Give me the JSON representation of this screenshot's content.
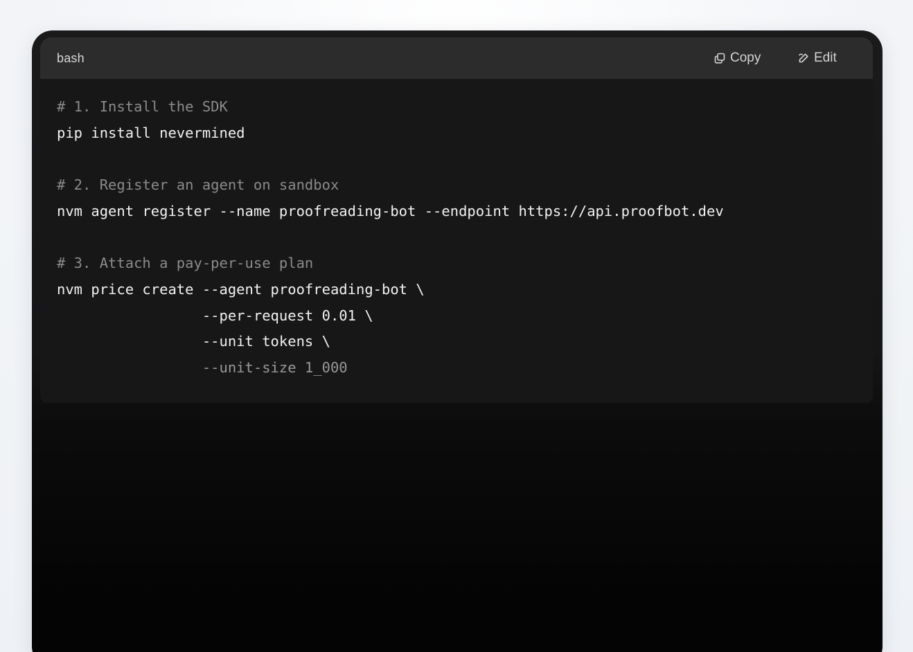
{
  "code_block": {
    "language": "bash",
    "copy_label": "Copy",
    "edit_label": "Edit",
    "lines": [
      {
        "text": "# 1. Install the SDK",
        "kind": "comment"
      },
      {
        "text": "pip install nevermined",
        "kind": "code"
      },
      {
        "text": "",
        "kind": "blank"
      },
      {
        "text": "# 2. Register an agent on sandbox",
        "kind": "comment"
      },
      {
        "text": "nvm agent register --name proofreading-bot --endpoint https://api.proofbot.dev",
        "kind": "code"
      },
      {
        "text": "",
        "kind": "blank"
      },
      {
        "text": "# 3. Attach a pay-per-use plan",
        "kind": "comment"
      },
      {
        "text": "nvm price create --agent proofreading-bot \\",
        "kind": "code"
      },
      {
        "text": "                 --per-request 0.01 \\",
        "kind": "code"
      },
      {
        "text": "                 --unit tokens \\",
        "kind": "code"
      },
      {
        "text": "                 --unit-size 1_000",
        "kind": "code-faded"
      }
    ]
  },
  "icons": {
    "copy": "copy-icon",
    "edit": "edit-pencil-icon"
  },
  "colors": {
    "header_bg": "#2c2c2d",
    "code_bg": "#171718",
    "comment": "#8b8b8b",
    "code_text": "#f2f2f2"
  }
}
